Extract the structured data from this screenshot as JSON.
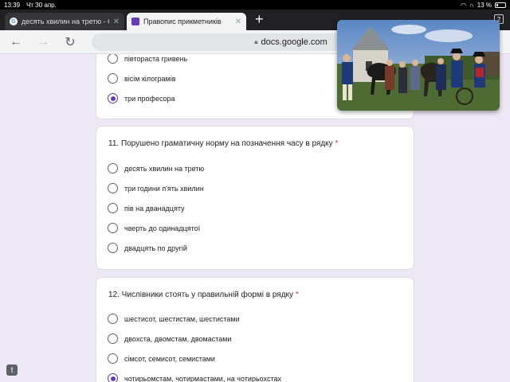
{
  "status": {
    "time": "13:39",
    "date": "Чт 30 апр.",
    "battery": "13 %"
  },
  "tabs": [
    {
      "title": "десять хвилин на третю - G",
      "active": false,
      "icon": "google-icon"
    },
    {
      "title": "Правопис прикметників",
      "active": true,
      "icon": "forms-icon"
    }
  ],
  "tab_count": "2",
  "toolbar": {
    "url": "docs.google.com"
  },
  "prev_card": {
    "options": [
      {
        "label": "півтораста гривень",
        "checked": false
      },
      {
        "label": "вісім кілограмів",
        "checked": false
      },
      {
        "label": "три професора",
        "checked": true
      }
    ]
  },
  "q11": {
    "title": "11. Порушено граматичну норму на позначення часу в рядку",
    "required_mark": "*",
    "options": [
      {
        "label": "десять хвилин на третю",
        "checked": false
      },
      {
        "label": "три години п'ять хвилин",
        "checked": false
      },
      {
        "label": "пів на дванадцяту",
        "checked": false
      },
      {
        "label": "чверть до одинадцятої",
        "checked": false
      },
      {
        "label": "двадцять по другій",
        "checked": false
      }
    ]
  },
  "q12": {
    "title": "12. Числівники стоять у правильній формі в рядку",
    "required_mark": "*",
    "options": [
      {
        "label": "шестисот, шестистам, шестистами",
        "checked": false
      },
      {
        "label": "двохста, двомстам, двомастами",
        "checked": false
      },
      {
        "label": "сімсот, семисот, семистами",
        "checked": false
      },
      {
        "label": "чотирьомстам, чотирмастами, на чотирьохстах",
        "checked": true
      }
    ]
  },
  "colors": {
    "accent": "#673ab7",
    "background": "#ede7f6",
    "required": "#d93025"
  }
}
